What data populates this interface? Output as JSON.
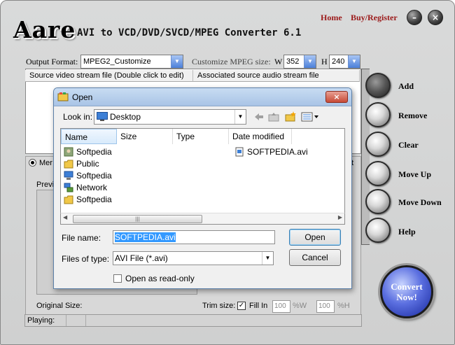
{
  "app": {
    "logo": "Aare",
    "title": "AVI to VCD/DVD/SVCD/MPEG Converter 6.1",
    "links": {
      "home": "Home",
      "buy": "Buy/Register"
    },
    "minimize_glyph": "–",
    "close_glyph": "×"
  },
  "settings": {
    "output_format_label": "Output Format:",
    "output_format_value": "MPEG2_Customize",
    "mpeg_size_label": "Customize MPEG size:",
    "w_label": "W",
    "w_value": "352",
    "h_label": "H",
    "h_value": "240"
  },
  "list": {
    "columns": [
      "Source video stream file (Double click to edit)",
      "Associated source audio stream file"
    ]
  },
  "side_buttons": [
    "Add",
    "Remove",
    "Clear",
    "Move Up",
    "Move Down",
    "Help"
  ],
  "convert_button": {
    "line1": "Convert",
    "line2": "Now!"
  },
  "lower": {
    "radio_label": "Mer",
    "right_partial": "t",
    "preview_label": "Previ",
    "original_size_label": "Original Size:",
    "trim_size_label": "Trim size:",
    "fill_in_label": "Fill In",
    "fill_in_checked": "✓",
    "trim_w_value": "100",
    "trim_w_unit": "%W",
    "trim_h_value": "100",
    "trim_h_unit": "%H"
  },
  "status": {
    "playing_label": "Playing:"
  },
  "dialog": {
    "title": "Open",
    "close_glyph": "×",
    "look_in_label": "Look in:",
    "look_in_value": "Desktop",
    "columns": [
      "Name",
      "Size",
      "Type",
      "Date modified"
    ],
    "items_left": [
      "Softpedia",
      "Public",
      "Softpedia",
      "Network",
      "Softpedia"
    ],
    "items_right": [
      "SOFTPEDIA.avi"
    ],
    "scroll_grip": "|||",
    "file_name_label": "File name:",
    "file_name_value": "SOFTPEDIA.avi",
    "file_type_label": "Files of type:",
    "file_type_value": "AVI File (*.avi)",
    "readonly_label": "Open as read-only",
    "open_button": "Open",
    "cancel_button": "Cancel"
  },
  "colors": {
    "link": "#9b1a1a",
    "dialog_title": "#a9c4e6",
    "selection": "#3399ff",
    "convert": "#5b6fe0"
  }
}
